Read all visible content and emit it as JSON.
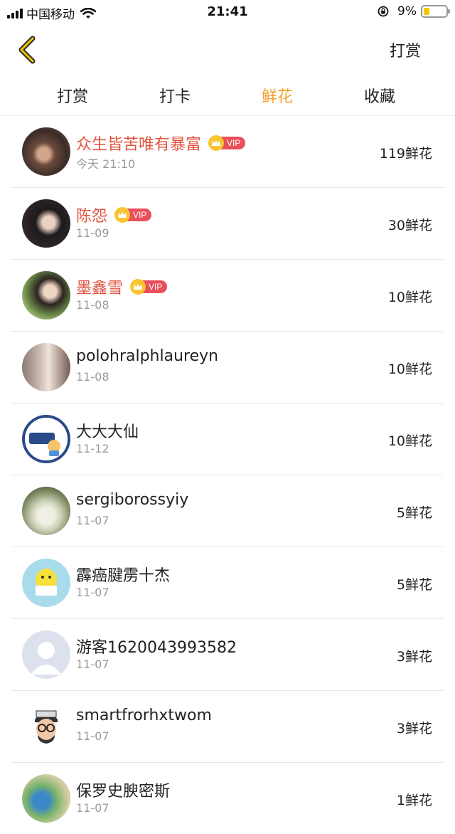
{
  "status_bar": {
    "carrier": "中国移动",
    "time": "21:41",
    "battery_text": "9%",
    "battery_level": 0.09
  },
  "nav": {
    "action_label": "打赏"
  },
  "tabs": [
    {
      "label": "打赏",
      "active": false
    },
    {
      "label": "打卡",
      "active": false
    },
    {
      "label": "鲜花",
      "active": true
    },
    {
      "label": "收藏",
      "active": false
    }
  ],
  "vip_label": "VIP",
  "list": [
    {
      "name": "众生皆苦唯有暴富",
      "date": "今天 21:10",
      "amount": "119鲜花",
      "vip": true
    },
    {
      "name": "陈怨",
      "date": "11-09",
      "amount": "30鲜花",
      "vip": true
    },
    {
      "name": "墨鑫雪",
      "date": "11-08",
      "amount": "10鲜花",
      "vip": true
    },
    {
      "name": "polohralphlaureyn",
      "date": "11-08",
      "amount": "10鲜花",
      "vip": false
    },
    {
      "name": "大大大仙",
      "date": "11-12",
      "amount": "10鲜花",
      "vip": false
    },
    {
      "name": "sergiborossyiy",
      "date": "11-07",
      "amount": "5鲜花",
      "vip": false
    },
    {
      "name": "霹癌腱雳十杰",
      "date": "11-07",
      "amount": "5鲜花",
      "vip": false
    },
    {
      "name": "游客1620043993582",
      "date": "11-07",
      "amount": "3鲜花",
      "vip": false
    },
    {
      "name": "smartfrorhxtwom",
      "date": "11-07",
      "amount": "3鲜花",
      "vip": false
    },
    {
      "name": "保罗史腴密斯",
      "date": "11-07",
      "amount": "1鲜花",
      "vip": false
    }
  ],
  "colors": {
    "accent": "#f0a12c",
    "vip_name": "#e2543f",
    "vip_badge": "#e8505b",
    "crown": "#f7c530"
  }
}
